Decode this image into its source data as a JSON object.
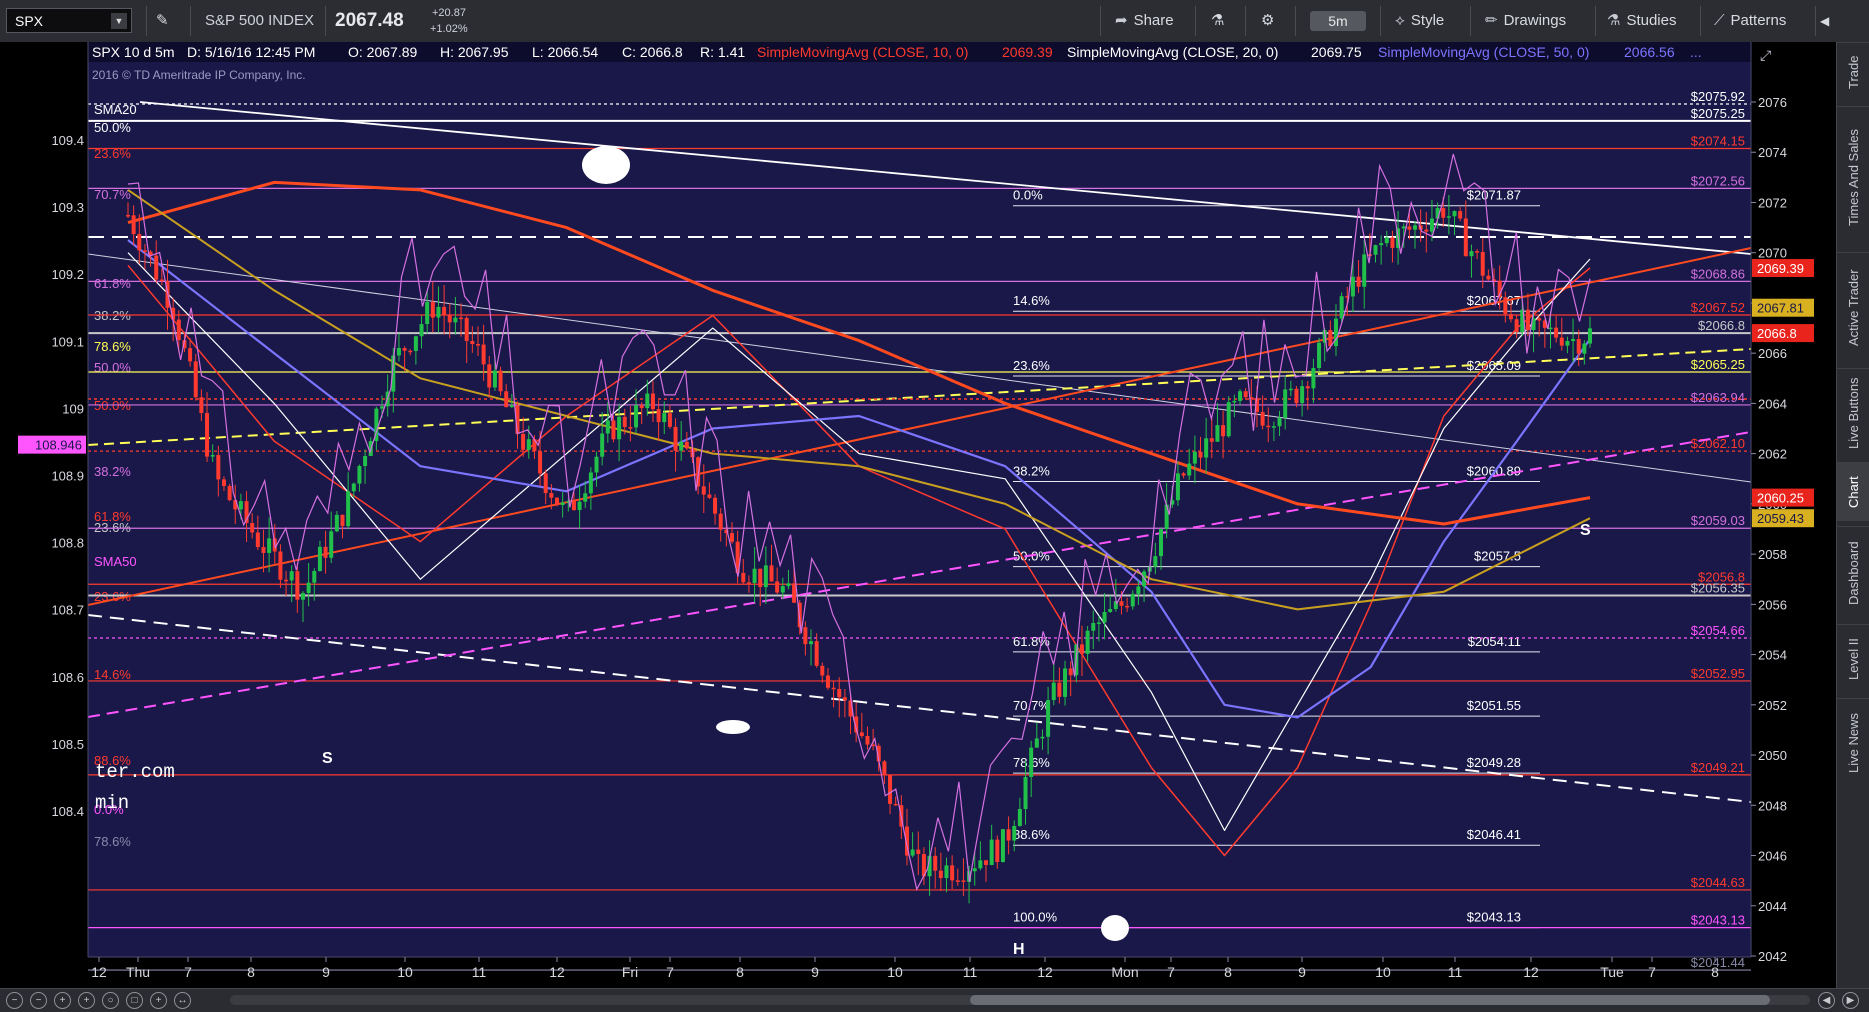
{
  "topbar": {
    "symbol": "SPX",
    "description": "S&P 500 INDEX",
    "last": "2067.48",
    "change": "+20.87",
    "change_pct": "+1.02%",
    "buttons": {
      "share": "Share",
      "timeframe": "5m",
      "style": "Style",
      "drawings": "Drawings",
      "studies": "Studies",
      "patterns": "Patterns"
    }
  },
  "chart_header": {
    "symbol_period": "SPX 10 d 5m",
    "date": "D: 5/16/16 12:45 PM",
    "open": "O: 2067.89",
    "high": "H: 2067.95",
    "low": "L: 2066.54",
    "close": "C: 2066.8",
    "range": "R: 1.41",
    "sma10_label": "SimpleMovingAvg (CLOSE, 10, 0)",
    "sma10_value": "2069.39",
    "sma20_label": "SimpleMovingAvg (CLOSE, 20, 0)",
    "sma20_value": "2069.75",
    "sma50_label": "SimpleMovingAvg (CLOSE, 50, 0)",
    "sma50_value": "2066.56",
    "copyright": "2016 © TD Ameritrade IP Company, Inc."
  },
  "colors": {
    "chart_bg": "#1a1849",
    "up_candle": "#21c04a",
    "down_candle": "#ff3a2e",
    "sma10": "#ff3a2e",
    "sma20": "#ffffff",
    "sma50": "#7b74ff",
    "sma200": "#ff4a1f",
    "yellow_ma": "#c8a020",
    "ratio_line": "#d470e0",
    "fib_magenta": "#ff55ff",
    "yellow_dashed": "#ffff55"
  },
  "right_tabs": [
    "Trade",
    "Times And Sales",
    "Active Trader",
    "Live Buttons",
    "Chart",
    "Dashboard",
    "Level II",
    "Live News"
  ],
  "chart_data": {
    "type": "line",
    "title": "SPX 10 d 5m",
    "price_axis": {
      "min": 2042,
      "max": 2076,
      "ticks": [
        2042,
        2044,
        2046,
        2048,
        2050,
        2052,
        2054,
        2056,
        2058,
        2060,
        2062,
        2064,
        2066,
        2068,
        2070,
        2072,
        2074,
        2076
      ]
    },
    "left_axis": {
      "min": 108.4,
      "max": 109.4,
      "ticks": [
        "108.4",
        "108.5",
        "108.6",
        "108.7",
        "108.8",
        "108.9",
        "109",
        "109.1",
        "109.2",
        "109.3",
        "109.4"
      ],
      "current": "108.946"
    },
    "time_axis": [
      "12",
      "Thu",
      "7",
      "8",
      "9",
      "10",
      "11",
      "12",
      "Fri",
      "7",
      "8",
      "9",
      "10",
      "11",
      "12",
      "Mon",
      "7",
      "8",
      "9",
      "10",
      "11",
      "12",
      "Tue",
      "7",
      "8"
    ],
    "series": [
      {
        "name": "SimpleMovingAvg (CLOSE, 10, 0)",
        "x": [
          0,
          10,
          20,
          30,
          40,
          50,
          60,
          70,
          75,
          80,
          85,
          90,
          95,
          100
        ],
        "values": [
          2069.5,
          2062.5,
          2058.5,
          2063.5,
          2067.5,
          2061.5,
          2059.0,
          2049.5,
          2046.0,
          2049.5,
          2056.0,
          2063.5,
          2067.0,
          2069.39
        ]
      },
      {
        "name": "SimpleMovingAvg (CLOSE, 20, 0)",
        "x": [
          0,
          10,
          20,
          30,
          40,
          50,
          60,
          70,
          75,
          80,
          85,
          90,
          95,
          100
        ],
        "values": [
          2070.0,
          2064.0,
          2057.0,
          2062.0,
          2067.0,
          2062.0,
          2061.0,
          2052.5,
          2047.0,
          2052.0,
          2057.0,
          2063.0,
          2066.5,
          2069.75
        ]
      },
      {
        "name": "SimpleMovingAvg (CLOSE, 50, 0)",
        "x": [
          0,
          10,
          20,
          30,
          40,
          50,
          60,
          70,
          75,
          80,
          85,
          90,
          95,
          100
        ],
        "values": [
          2070.5,
          2066.0,
          2061.5,
          2060.5,
          2063.0,
          2063.5,
          2061.5,
          2056.5,
          2052.0,
          2051.5,
          2053.5,
          2058.5,
          2062.5,
          2066.56
        ]
      },
      {
        "name": "",
        "x": [
          0,
          10,
          20,
          30,
          40,
          50,
          60,
          70,
          80,
          90,
          100
        ],
        "values": [
          2071.2,
          2072.8,
          2072.5,
          2071.0,
          2068.5,
          2066.5,
          2064.0,
          2062.0,
          2060.0,
          2059.2,
          2060.25
        ]
      },
      {
        "name": "",
        "x": [
          0,
          10,
          20,
          30,
          40,
          50,
          60,
          70,
          80,
          90,
          100
        ],
        "values": [
          2072.5,
          2068.5,
          2065.0,
          2063.5,
          2062.0,
          2061.5,
          2060.0,
          2057.0,
          2055.8,
          2056.5,
          2059.43
        ]
      }
    ],
    "price_series": {
      "name": "SPX",
      "x": [
        0,
        3,
        6,
        9,
        12,
        15,
        18,
        21,
        24,
        27,
        30,
        33,
        36,
        39,
        42,
        45,
        48,
        51,
        54,
        57,
        60,
        63,
        66,
        68,
        70,
        72,
        74,
        76,
        78,
        80,
        82,
        84,
        86,
        88,
        90,
        92,
        94,
        96,
        98,
        99,
        100
      ],
      "values": [
        2071.5,
        2068.0,
        2061.0,
        2058.5,
        2056.5,
        2060.0,
        2065.5,
        2068.0,
        2066.0,
        2062.5,
        2059.5,
        2063.0,
        2064.0,
        2061.0,
        2057.5,
        2056.5,
        2053.0,
        2050.0,
        2045.5,
        2045.5,
        2046.5,
        2052.0,
        2055.0,
        2056.0,
        2058.0,
        2061.0,
        2062.5,
        2064.0,
        2063.5,
        2064.5,
        2066.5,
        2069.0,
        2070.5,
        2071.0,
        2071.8,
        2070.0,
        2068.0,
        2066.8,
        2066.8,
        2066.5,
        2066.8
      ]
    },
    "horizontal_levels": [
      {
        "label": "$2075.92",
        "value": 2075.92
      },
      {
        "label": "$2075.25",
        "value": 2075.25
      },
      {
        "label": "$2074.15",
        "value": 2074.15
      },
      {
        "label": "$2072.56",
        "value": 2072.56
      },
      {
        "label": "$2068.86",
        "value": 2068.86
      },
      {
        "label": "$2067.52",
        "value": 2067.52
      },
      {
        "label": "$2066.8",
        "value": 2066.8
      },
      {
        "label": "$2065.25",
        "value": 2065.25
      },
      {
        "label": "$2063.94",
        "value": 2063.94
      },
      {
        "label": "$2062.10",
        "value": 2062.1
      },
      {
        "label": "$2059.03",
        "value": 2059.03
      },
      {
        "label": "$2056.8",
        "value": 2056.8
      },
      {
        "label": "$2056.35",
        "value": 2056.35
      },
      {
        "label": "$2054.66",
        "value": 2054.66
      },
      {
        "label": "$2052.95",
        "value": 2052.95
      },
      {
        "label": "$2049.21",
        "value": 2049.21
      },
      {
        "label": "$2044.63",
        "value": 2044.63
      },
      {
        "label": "$2043.13",
        "value": 2043.13
      },
      {
        "label": "$2041.44",
        "value": 2041.44
      }
    ],
    "fib_retracement": [
      {
        "pct": "0.0%",
        "label": "$2071.87",
        "value": 2071.87
      },
      {
        "pct": "14.6%",
        "label": "$2067.67",
        "value": 2067.67
      },
      {
        "pct": "23.6%",
        "label": "$2065.09",
        "value": 2065.09
      },
      {
        "pct": "38.2%",
        "label": "$2060.89",
        "value": 2060.89
      },
      {
        "pct": "50.0%",
        "label": "$2057.5",
        "value": 2057.5
      },
      {
        "pct": "61.8%",
        "label": "$2054.11",
        "value": 2054.11
      },
      {
        "pct": "70.7%",
        "label": "$2051.55",
        "value": 2051.55
      },
      {
        "pct": "78.6%",
        "label": "$2049.28",
        "value": 2049.28
      },
      {
        "pct": "88.6%",
        "label": "$2046.41",
        "value": 2046.41
      },
      {
        "pct": "100.0%",
        "label": "$2043.13",
        "value": 2043.13
      }
    ],
    "left_labels": [
      "SMA20",
      "50.0%",
      "23.6%",
      "70.7%",
      "61.8%",
      "38.2%",
      "78.6%",
      "50.0%",
      "50.0%",
      "38.2%",
      "61.8%",
      "23.6%",
      "SMA50",
      "23.6%",
      "14.6%",
      "88.6%",
      "0.0%",
      "78.6%"
    ],
    "price_tags": [
      {
        "label": "2069.39",
        "value": 2069.39,
        "color": "#e8241c"
      },
      {
        "label": "2067.81",
        "value": 2067.81,
        "color": "#d8b020"
      },
      {
        "label": "2066.8",
        "value": 2066.8,
        "color": "#e8241c"
      },
      {
        "label": "2060.25",
        "value": 2060.25,
        "color": "#e8241c"
      },
      {
        "label": "2059.43",
        "value": 2059.43,
        "color": "#d8b020"
      }
    ],
    "annotations": [
      "S",
      "S",
      "H"
    ],
    "watermark": [
      "ter.com",
      "min"
    ]
  }
}
